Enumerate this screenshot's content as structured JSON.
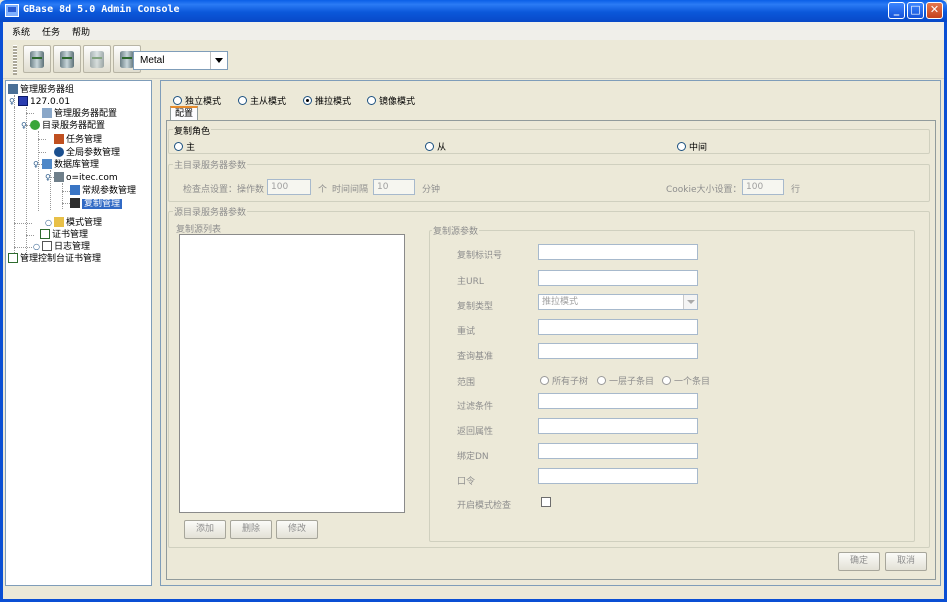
{
  "window": {
    "title": "GBase 8d 5.0 Admin Console",
    "controls": {
      "minimize": "_",
      "maximize": "□",
      "close": "✕"
    }
  },
  "menu": [
    "系统",
    "任务",
    "帮助"
  ],
  "toolbar": {
    "buttons": [
      "database-icon",
      "database-icon",
      "database-icon",
      "database-icon"
    ],
    "theme_combo": "Metal"
  },
  "tree": {
    "root": "管理服务器组",
    "server": "127.0.01",
    "manage_config": "管理服务器配置",
    "directory_config": "目录服务器配置",
    "task_mgmt": "任务管理",
    "global_params": "全局参数管理",
    "db_mgmt": "数据库管理",
    "db_node": "o=itec.com",
    "regular_params": "常规参数管理",
    "replication_mgmt": "复制管理",
    "schema_mgmt": "模式管理",
    "cert_mgmt": "证书管理",
    "log_mgmt": "日志管理",
    "console_cert": "管理控制台证书管理"
  },
  "mode_radios": [
    {
      "label": "独立模式",
      "selected": false
    },
    {
      "label": "主从模式",
      "selected": false
    },
    {
      "label": "推拉模式",
      "selected": true
    },
    {
      "label": "镜像模式",
      "selected": false
    }
  ],
  "tab_label": "配置",
  "role_group": {
    "title": "复制角色",
    "options": [
      {
        "label": "主",
        "selected": false
      },
      {
        "label": "从",
        "selected": false
      },
      {
        "label": "中间",
        "selected": false
      }
    ]
  },
  "master_params": {
    "title": "主目录服务器参数",
    "checkpoint_label": "检查点设置：操作数",
    "op_count": "100",
    "unit_count": "个",
    "interval_label": "时间间隔",
    "interval": "10",
    "unit_minute": "分钟",
    "cookie_label": "Cookie大小设置：",
    "cookie_size": "100",
    "unit_line": "行"
  },
  "source_params": {
    "title": "源目录服务器参数",
    "list_title": "复制源列表",
    "buttons": [
      "添加",
      "删除",
      "修改"
    ],
    "params_title": "复制源参数",
    "fields": {
      "rep_id": "复制标识号",
      "main_url": "主URL",
      "rep_type": "复制类型",
      "rep_type_value": "推拉模式",
      "retry": "重试",
      "query_base": "查询基准",
      "scope": "范围",
      "scope_options": [
        "所有子树",
        "一层子条目",
        "一个条目"
      ],
      "filter": "过滤条件",
      "return_attrs": "返回属性",
      "bind_dn": "绑定DN",
      "password": "口令",
      "schema_check": "开启模式检查"
    }
  },
  "footer_buttons": {
    "ok": "确定",
    "cancel": "取消"
  }
}
